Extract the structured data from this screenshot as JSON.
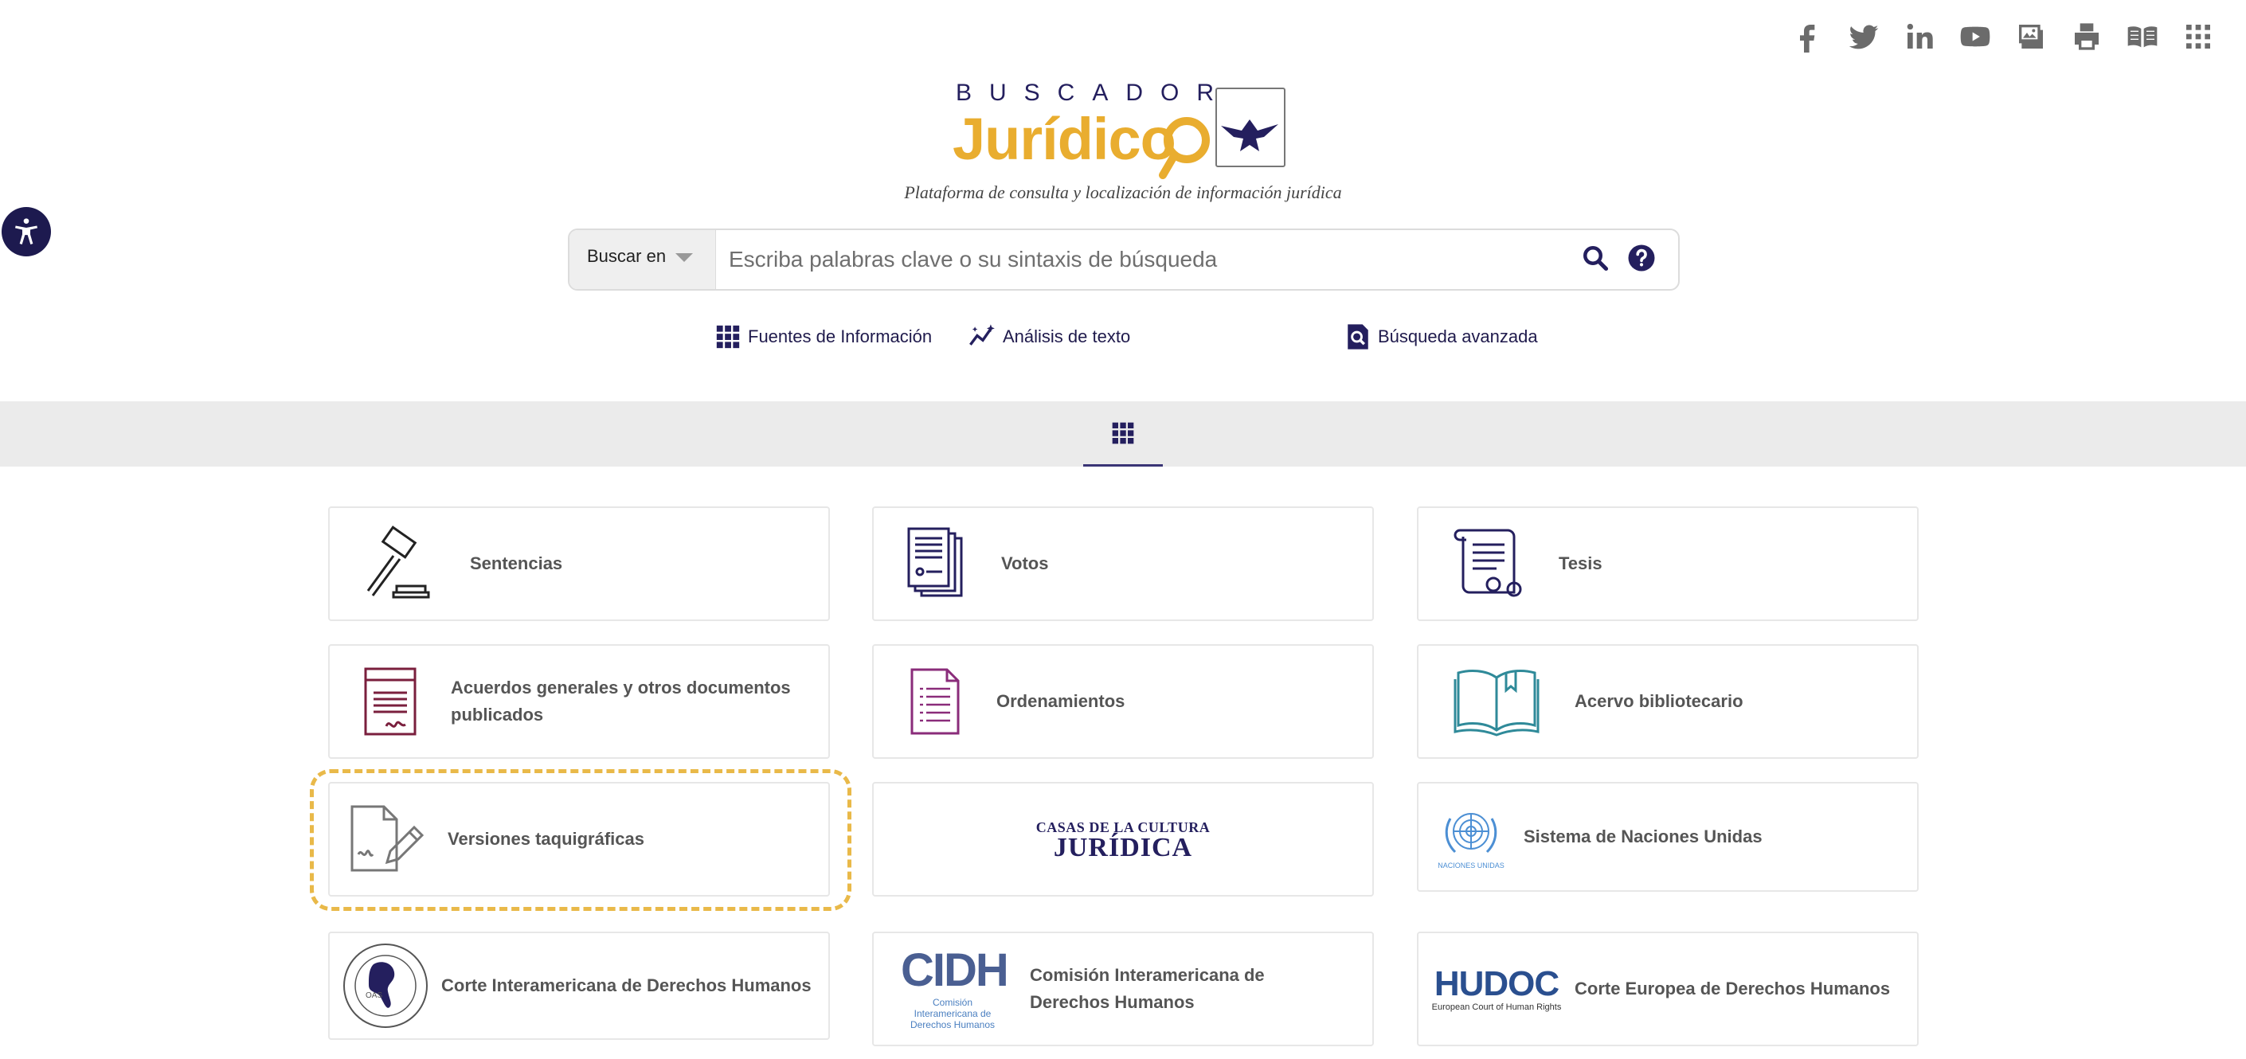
{
  "header": {
    "social": [
      {
        "icon": "facebook-icon"
      },
      {
        "icon": "twitter-icon"
      },
      {
        "icon": "linkedin-icon"
      },
      {
        "icon": "youtube-icon"
      },
      {
        "icon": "gallery-icon"
      },
      {
        "icon": "printer-icon"
      },
      {
        "icon": "book-icon"
      },
      {
        "icon": "apps-grid-icon"
      }
    ]
  },
  "logo": {
    "top_text": "BUSCADOR",
    "main_text": "Jurídico",
    "tagline": "Plataforma de consulta y localización de información jurídica"
  },
  "search": {
    "scope_label": "Buscar en",
    "placeholder": "Escriba palabras clave o su sintaxis de búsqueda",
    "value": ""
  },
  "links": {
    "fuentes": "Fuentes de Información",
    "analisis": "Análisis de texto",
    "avanzada": "Búsqueda avanzada"
  },
  "cards": [
    {
      "label": "Sentencias"
    },
    {
      "label": "Votos"
    },
    {
      "label": "Tesis"
    },
    {
      "label": "Acuerdos generales y otros documentos publicados"
    },
    {
      "label": "Ordenamientos"
    },
    {
      "label": "Acervo bibliotecario"
    },
    {
      "label": "Versiones taquigráficas"
    },
    {
      "label": "CASAS DE LA CULTURA JURÍDICA",
      "logo_top": "CASAS DE LA CULTURA",
      "logo_bottom": "JURÍDICA"
    },
    {
      "label": "Sistema de Naciones Unidas",
      "logo_caption": "NACIONES UNIDAS"
    },
    {
      "label": "Corte Interamericana de Derechos Humanos",
      "seal_text": "OAS"
    },
    {
      "label": "Comisión Interamericana de Derechos Humanos",
      "logo_text": "CIDH",
      "logo_sub": "Comisión Interamericana de Derechos Humanos"
    },
    {
      "label": "Corte Europea de Derechos Humanos",
      "logo_text": "HUDOC",
      "logo_sub": "European Court of Human Rights"
    }
  ],
  "colors": {
    "brand_navy": "#241f5e",
    "brand_gold": "#e9ad2f",
    "highlight": "#e9b949",
    "maroon": "#7a1f3d",
    "purple": "#8a2c7a",
    "teal": "#2f8a99"
  }
}
